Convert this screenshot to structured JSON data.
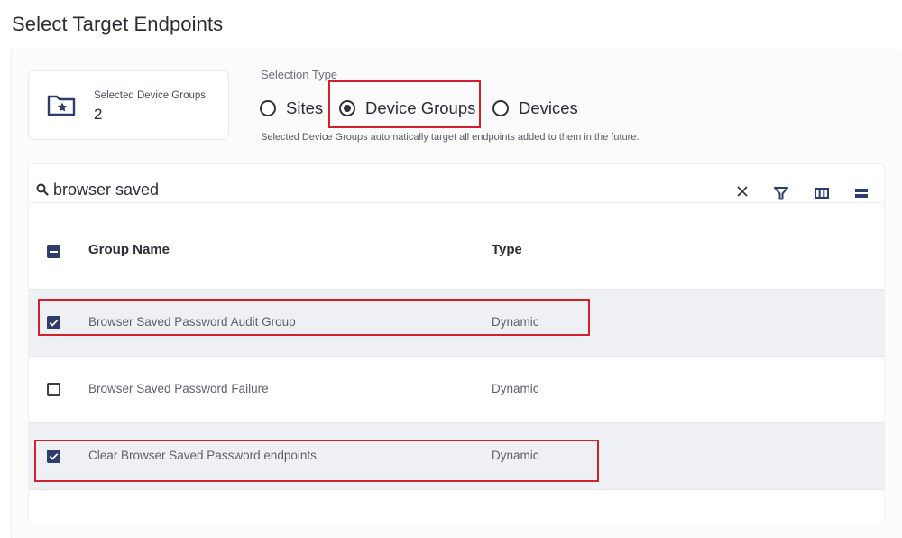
{
  "page": {
    "title": "Select Target Endpoints"
  },
  "summary": {
    "label": "Selected Device Groups",
    "count": "2",
    "icon": "folder-star-icon"
  },
  "selection_type": {
    "label": "Selection Type",
    "options": [
      {
        "label": "Sites",
        "checked": false
      },
      {
        "label": "Device Groups",
        "checked": true
      },
      {
        "label": "Devices",
        "checked": false
      }
    ],
    "hint": "Selected Device Groups automatically target all endpoints added to them in the future."
  },
  "search": {
    "value": "browser saved"
  },
  "table": {
    "columns": {
      "name": "Group Name",
      "type": "Type"
    },
    "rows": [
      {
        "name": "Browser Saved Password Audit Group",
        "type": "Dynamic",
        "checked": true
      },
      {
        "name": "Browser Saved Password Failure",
        "type": "Dynamic",
        "checked": false
      },
      {
        "name": "Clear Browser Saved Password endpoints",
        "type": "Dynamic",
        "checked": true
      }
    ]
  },
  "colors": {
    "accent": "#2e3d6a",
    "highlight": "#d0212c",
    "selected_row": "#eef0f4"
  }
}
